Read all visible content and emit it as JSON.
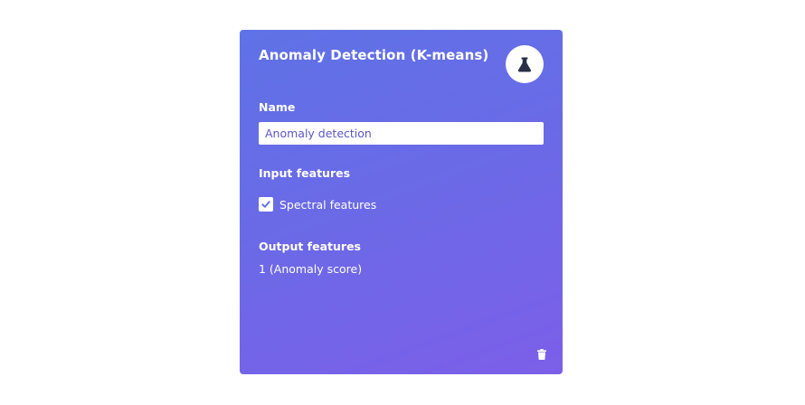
{
  "block": {
    "title": "Anomaly Detection (K-means)",
    "icon": "flask-icon",
    "name_label": "Name",
    "name_value": "Anomaly detection",
    "input_features_label": "Input features",
    "input_features": [
      {
        "label": "Spectral features",
        "checked": true
      }
    ],
    "output_features_label": "Output features",
    "output_features_value": "1 (Anomaly score)",
    "delete_icon": "trash-icon"
  },
  "colors": {
    "gradient_start": "#5f72e6",
    "gradient_end": "#7c5fe8",
    "icon_color": "#2a2f45",
    "input_text": "#5a55c8"
  }
}
